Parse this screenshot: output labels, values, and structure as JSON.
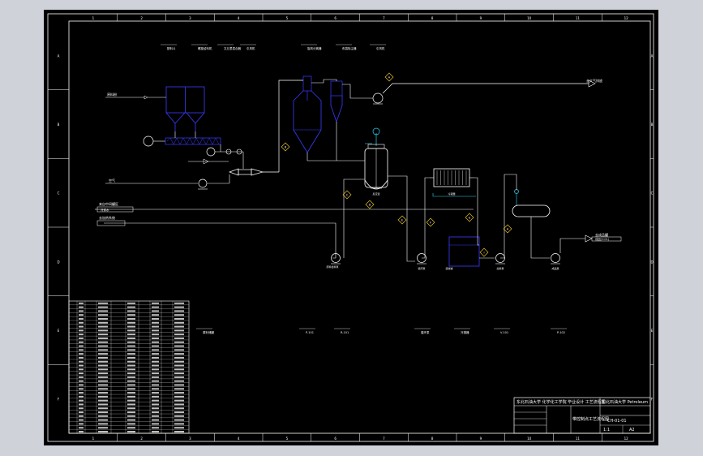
{
  "drawing": {
    "border_letters": [
      "A",
      "B",
      "C",
      "D",
      "E",
      "F"
    ],
    "border_numbers": [
      "1",
      "2",
      "3",
      "4",
      "5",
      "6",
      "7",
      "8",
      "9",
      "10",
      "11",
      "12"
    ],
    "top_labels": [
      "配料斗",
      "螺旋给料机",
      "文丘里混合器",
      "引风机",
      "旋风分离器",
      "布袋除尘器",
      "引风机"
    ],
    "streams": {
      "s1": "原料粉",
      "s2": "空气",
      "s3": "来自中间罐区",
      "s4": "冷却水",
      "s5": "去加热系统",
      "exhaust": "去大气排放",
      "product": "去成品罐",
      "product_sub": "成品(Y-01)"
    },
    "valve_tags": [
      "A",
      "B",
      "C",
      "D",
      "E",
      "F",
      "G",
      "H",
      "I"
    ],
    "equipment_labels": [
      "原料给料泵",
      "反应釜",
      "循环泵",
      "冷凝器",
      "接收罐",
      "出料泵",
      "成品泵"
    ],
    "bottom_labels": [
      "原料储罐",
      "P-101",
      "R-101",
      "循环泵",
      "冷凝器",
      "V-101",
      "P-102"
    ],
    "title_block": {
      "project": "东北石油大学 化学化工学院 毕业设计 工艺流程图",
      "school": "东北石油大学 Petroleum",
      "drawing_name": "带控制点工艺流程图",
      "drawing_no": "CH-01-01",
      "scale": "1:1",
      "sheet": "A2"
    }
  }
}
